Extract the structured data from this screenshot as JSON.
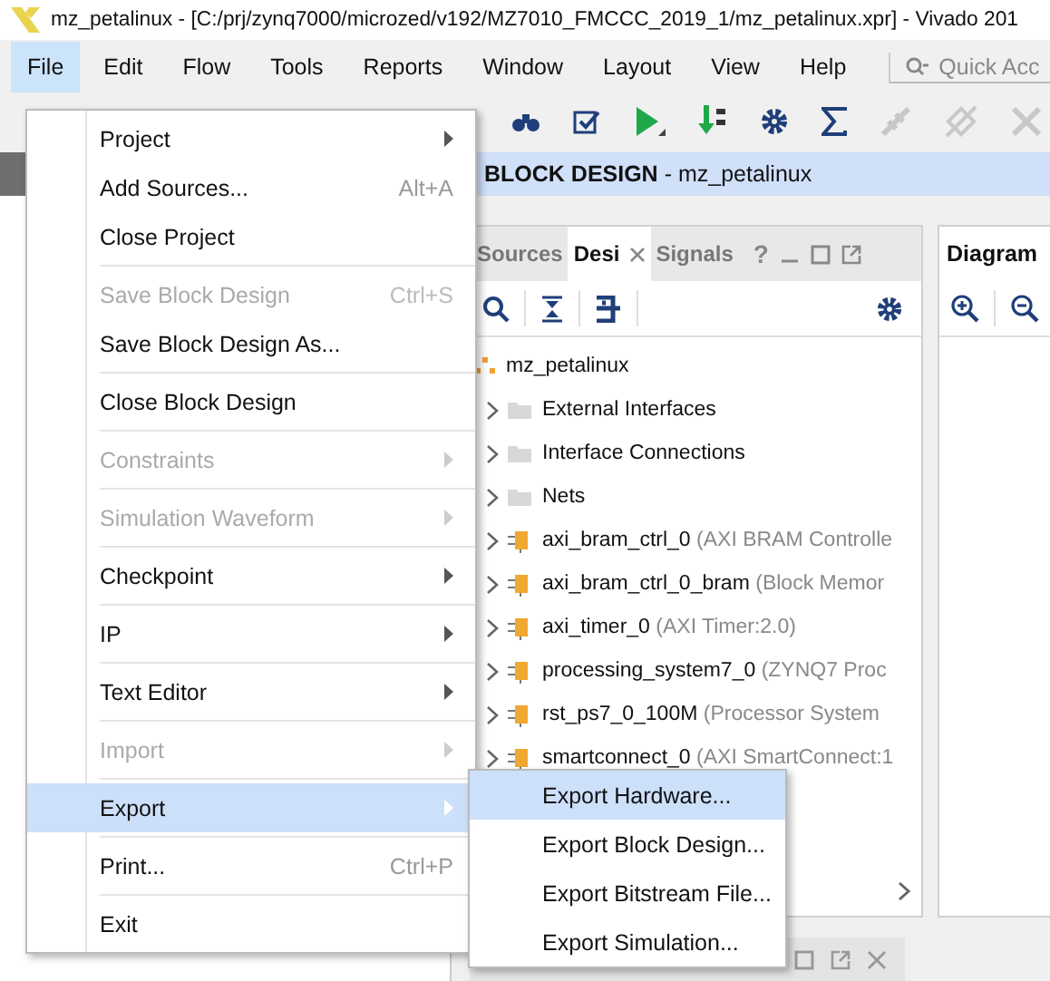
{
  "window": {
    "title": "mz_petalinux - [C:/prj/zynq7000/microzed/v192/MZ7010_FMCCC_2019_1/mz_petalinux.xpr] - Vivado 201"
  },
  "menu_bar": [
    {
      "label": "File",
      "selected": true
    },
    {
      "label": "Edit",
      "selected": false
    },
    {
      "label": "Flow",
      "selected": false
    },
    {
      "label": "Tools",
      "selected": false
    },
    {
      "label": "Reports",
      "selected": false
    },
    {
      "label": "Window",
      "selected": false
    },
    {
      "label": "Layout",
      "selected": false
    },
    {
      "label": "View",
      "selected": false
    },
    {
      "label": "Help",
      "selected": false
    }
  ],
  "quick_access": {
    "placeholder": "Quick Acc"
  },
  "header": {
    "text": "**BLOCK DESIGN** - mz_petalinux"
  },
  "design_panel": {
    "tabs": [
      {
        "label": "Sources",
        "selected": false,
        "closable": false
      },
      {
        "label": "Desi",
        "selected": true,
        "closable": true
      },
      {
        "label": "Signals",
        "selected": false,
        "closable": false
      }
    ],
    "help": "?",
    "tree": {
      "label": "mz_petalinux",
      "children": [
        {
          "kind": "folder",
          "name": "External Interfaces",
          "expanded": false
        },
        {
          "kind": "folder",
          "name": "Interface Connections",
          "expanded": false
        },
        {
          "kind": "folder",
          "name": "Nets",
          "expanded": false
        },
        {
          "kind": "cell",
          "name": "axi_bram_ctrl_0",
          "detail": "(AXI BRAM Controlle",
          "expanded": false
        },
        {
          "kind": "cell",
          "name": "axi_bram_ctrl_0_bram",
          "detail": "(Block Memor",
          "expanded": false
        },
        {
          "kind": "cell",
          "name": "axi_timer_0",
          "detail": "(AXI Timer:2.0)",
          "expanded": false
        },
        {
          "kind": "cell",
          "name": "processing_system7_0",
          "detail": "(ZYNQ7 Proc",
          "expanded": false
        },
        {
          "kind": "cell",
          "name": "rst_ps7_0_100M",
          "detail": "(Processor System",
          "expanded": false
        },
        {
          "kind": "cell",
          "name": "smartconnect_0",
          "detail": "(AXI SmartConnect:1",
          "expanded": false
        }
      ]
    }
  },
  "diagram_panel": {
    "tab": "Diagram"
  },
  "file_menu": {
    "groups": [
      [
        {
          "label": "Project",
          "submenu": true,
          "disabled": false,
          "selected": false
        },
        {
          "label": "Add Sources...",
          "shortcut": "Alt+A",
          "submenu": false,
          "disabled": false,
          "selected": false
        },
        {
          "label": "Close Project",
          "submenu": false,
          "disabled": false,
          "selected": false
        }
      ],
      [
        {
          "label": "Save Block Design",
          "shortcut": "Ctrl+S",
          "submenu": false,
          "disabled": true,
          "selected": false
        },
        {
          "label": "Save Block Design As...",
          "submenu": false,
          "disabled": false,
          "selected": false
        }
      ],
      [
        {
          "label": "Close Block Design",
          "submenu": false,
          "disabled": false,
          "selected": false
        }
      ],
      [
        {
          "label": "Constraints",
          "submenu": true,
          "disabled": true,
          "selected": false
        }
      ],
      [
        {
          "label": "Simulation Waveform",
          "submenu": true,
          "disabled": true,
          "selected": false
        }
      ],
      [
        {
          "label": "Checkpoint",
          "submenu": true,
          "disabled": false,
          "selected": false
        }
      ],
      [
        {
          "label": "IP",
          "submenu": true,
          "disabled": false,
          "selected": false
        }
      ],
      [
        {
          "label": "Text Editor",
          "submenu": true,
          "disabled": false,
          "selected": false
        }
      ],
      [
        {
          "label": "Import",
          "submenu": true,
          "disabled": true,
          "selected": false
        }
      ],
      [
        {
          "label": "Export",
          "submenu": true,
          "disabled": false,
          "selected": true
        }
      ],
      [
        {
          "label": "Print...",
          "shortcut": "Ctrl+P",
          "submenu": false,
          "disabled": false,
          "selected": false
        }
      ],
      [
        {
          "label": "Exit",
          "submenu": false,
          "disabled": false,
          "selected": false
        }
      ]
    ]
  },
  "export_submenu": [
    {
      "label": "Export Hardware...",
      "selected": true
    },
    {
      "label": "Export Block Design...",
      "selected": false
    },
    {
      "label": "Export Bitstream File...",
      "selected": false
    },
    {
      "label": "Export Simulation...",
      "selected": false
    }
  ]
}
